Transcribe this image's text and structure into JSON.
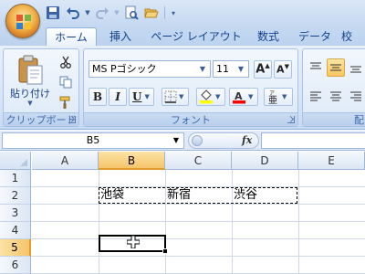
{
  "colors": {
    "accent": "#15428b",
    "ribbon_bg": "#dbe7f6",
    "selection_header": "#f6c46a",
    "highlight_yellow": "#ffff00",
    "font_red": "#ff0000"
  },
  "qat": {
    "icons": [
      "save-icon",
      "undo-icon",
      "redo-icon",
      "print-preview-icon",
      "open-icon",
      "customize-qat-icon"
    ]
  },
  "tabs": [
    "ホーム",
    "挿入",
    "ページ レイアウト",
    "数式",
    "データ",
    "校"
  ],
  "ribbon": {
    "clipboard": {
      "paste_label": "貼り付け",
      "group_label": "クリップボード"
    },
    "font": {
      "font_name": "MS Pゴシック",
      "font_size": "11",
      "bold": "B",
      "italic": "I",
      "underline": "U",
      "group_label": "フォント"
    },
    "alignment": {
      "group_label": "配"
    }
  },
  "formula_bar": {
    "name_box": "B5",
    "fx_label": "fx",
    "formula": ""
  },
  "sheet": {
    "columns": [
      "A",
      "B",
      "C",
      "D",
      "E"
    ],
    "selected_column": "B",
    "rows": [
      "1",
      "2",
      "3",
      "4",
      "5",
      "6"
    ],
    "selected_row": "5",
    "cells": {
      "B2": "池袋",
      "C2": "新宿",
      "D2": "渋谷"
    }
  }
}
